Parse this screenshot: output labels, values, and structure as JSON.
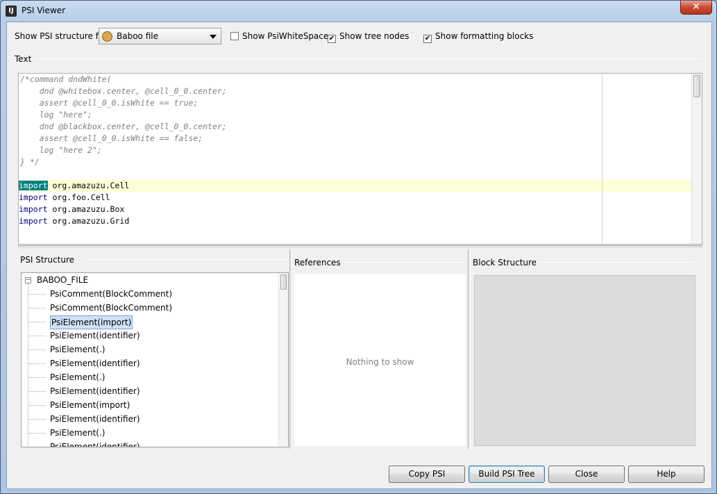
{
  "window": {
    "title": "PSI Viewer",
    "close_glyph": "✕"
  },
  "toolbar": {
    "structure_label": "Show PSI structure for:",
    "file_type": {
      "value": "Baboo file",
      "icon": "baboo-file-icon"
    },
    "checkboxes": [
      {
        "label": "Show PsiWhiteSpace",
        "checked": false
      },
      {
        "label": "Show tree nodes",
        "checked": true
      },
      {
        "label": "Show formatting blocks",
        "checked": true
      }
    ]
  },
  "text_section": {
    "label": "Text"
  },
  "editor": {
    "lines": [
      {
        "text": "/*command dndWhite(",
        "style": "comment"
      },
      {
        "text": "    dnd @whitebox.center, @cell_0_0.center;",
        "style": "comment"
      },
      {
        "text": "    assert @cell_0_0.isWhite == true;",
        "style": "comment"
      },
      {
        "text": "    log \"here\";",
        "style": "comment"
      },
      {
        "text": "    dnd @blackbox.center, @cell_0_0.center;",
        "style": "comment"
      },
      {
        "text": "    assert @cell_0_0.isWhite == false;",
        "style": "comment"
      },
      {
        "text": "    log \"here 2\";",
        "style": "comment"
      },
      {
        "text": "} */",
        "style": "comment"
      },
      {
        "text": "",
        "style": "plain"
      },
      {
        "keyword": "import",
        "text": " org.amazuzu.Cell",
        "style": "import",
        "selected": true
      },
      {
        "keyword": "import",
        "text": " org.foo.Cell",
        "style": "import"
      },
      {
        "keyword": "import",
        "text": " org.amazuzu.Box",
        "style": "import"
      },
      {
        "keyword": "import",
        "text": " org.amazuzu.Grid",
        "style": "import"
      }
    ]
  },
  "psi_panel": {
    "title": "PSI Structure",
    "root": "BABOO_FILE",
    "items": [
      "PsiComment(BlockComment)",
      "PsiComment(BlockComment)",
      "PsiElement(import)",
      "PsiElement(identifier)",
      "PsiElement(.)",
      "PsiElement(identifier)",
      "PsiElement(.)",
      "PsiElement(identifier)",
      "PsiElement(import)",
      "PsiElement(identifier)",
      "PsiElement(.)",
      "PsiElement(identifier)"
    ],
    "selected_index": 2
  },
  "references_panel": {
    "title": "References",
    "empty_text": "Nothing to show"
  },
  "block_panel": {
    "title": "Block Structure"
  },
  "buttons": {
    "copy_psi": "Copy PSI",
    "build_psi_tree": "Build PSI Tree",
    "close": "Close",
    "help": "Help"
  }
}
